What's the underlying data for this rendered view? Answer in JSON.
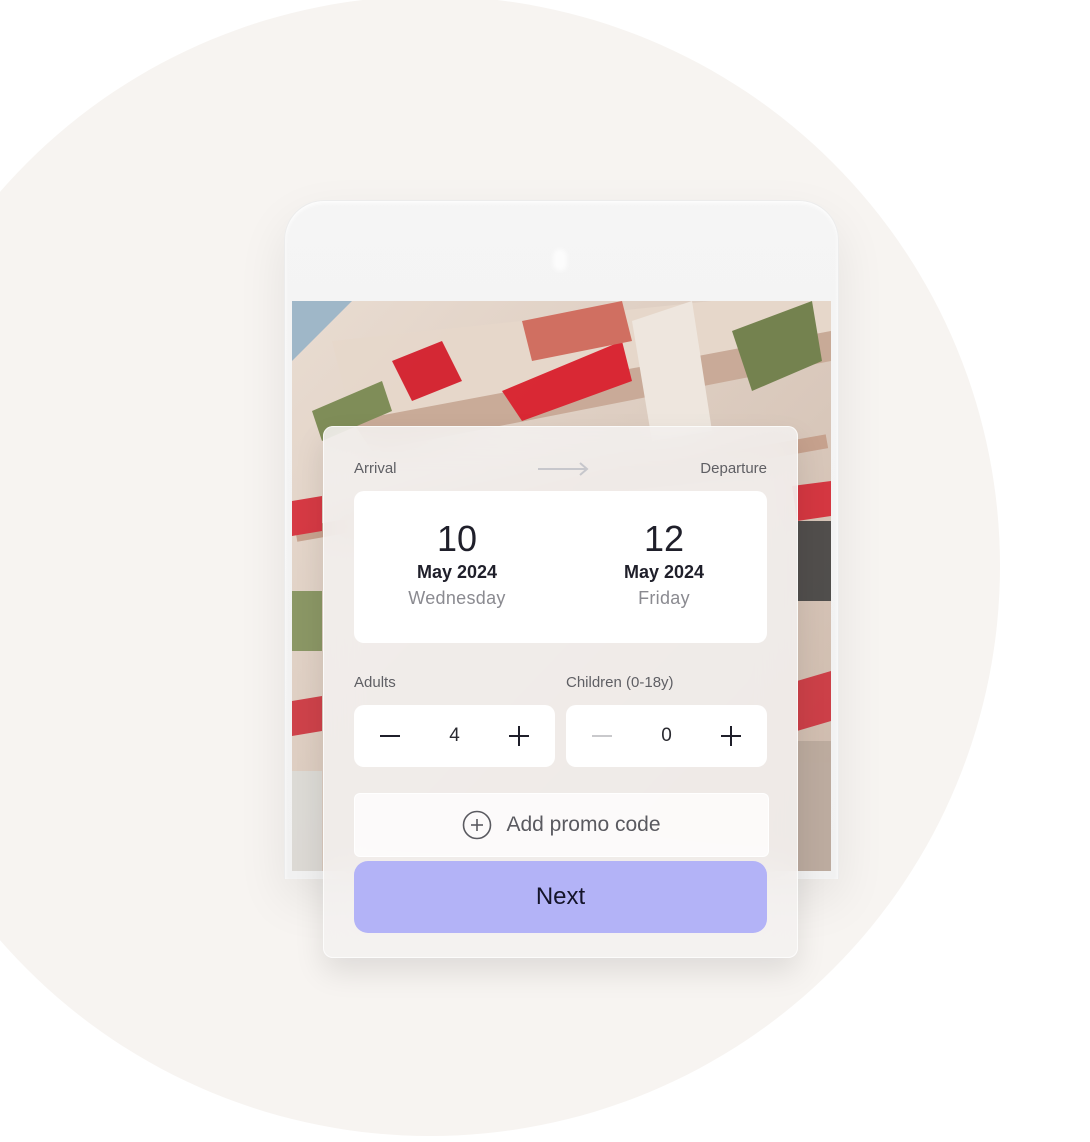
{
  "booking": {
    "arrival_label": "Arrival",
    "departure_label": "Departure",
    "arrival": {
      "day": "10",
      "month_year": "May 2024",
      "weekday": "Wednesday"
    },
    "departure": {
      "day": "12",
      "month_year": "May 2024",
      "weekday": "Friday"
    },
    "adults": {
      "label": "Adults",
      "value": "4"
    },
    "children": {
      "label": "Children (0-18y)",
      "value": "0"
    },
    "promo_label": "Add promo code",
    "next_label": "Next"
  },
  "colors": {
    "background_circle": "#f7f4f1",
    "primary_button": "#b3b3f7",
    "text_dark": "#1f1f2a",
    "text_muted": "#8a8a90"
  },
  "icons": {
    "arrow": "arrow-right-icon",
    "minus": "minus-icon",
    "plus": "plus-icon",
    "promo": "plus-circle-icon"
  }
}
